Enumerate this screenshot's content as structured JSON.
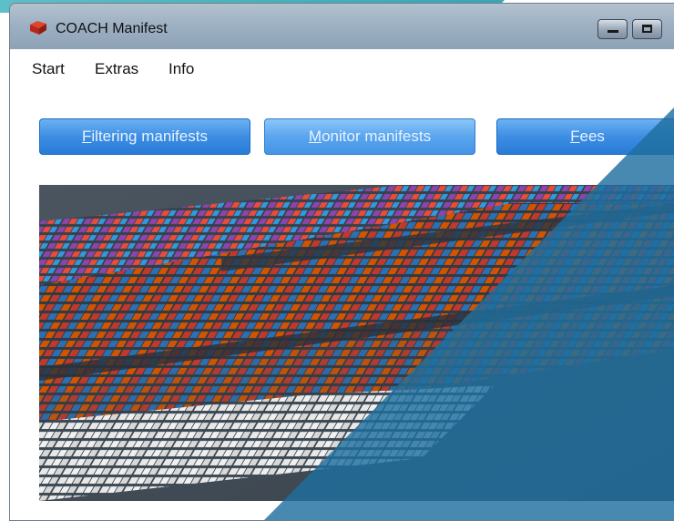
{
  "window": {
    "title": "COACH Manifest"
  },
  "menu": {
    "items": [
      "Start",
      "Extras",
      "Info"
    ]
  },
  "nav_buttons": [
    {
      "prefix": "",
      "accel": "F",
      "rest": "iltering manifests"
    },
    {
      "prefix": "",
      "accel": "M",
      "rest": "onitor manifests"
    },
    {
      "prefix": "",
      "accel": "F",
      "rest": "ees"
    }
  ],
  "image": {
    "icon": "container-terminal-photo"
  },
  "colors": {
    "accent": "#3d8ee3",
    "overlay": "#1f6f9f",
    "teal": "#3aa6b4"
  }
}
